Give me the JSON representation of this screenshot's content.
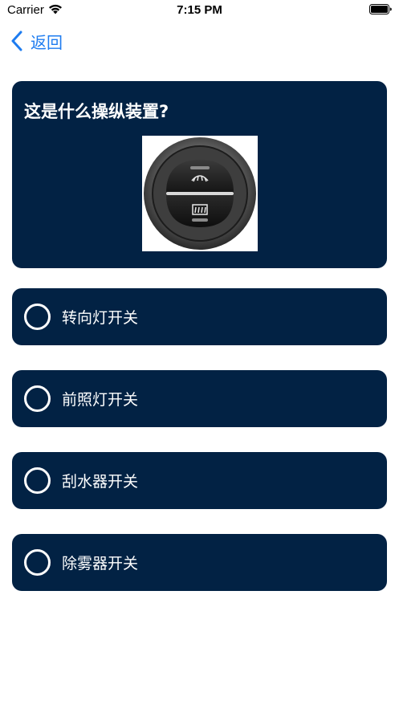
{
  "status_bar": {
    "carrier": "Carrier",
    "time": "7:15 PM"
  },
  "nav": {
    "back_label": "返回"
  },
  "question": {
    "text": "这是什么操纵装置?"
  },
  "options": [
    {
      "label": "转向灯开关"
    },
    {
      "label": "前照灯开关"
    },
    {
      "label": "刮水器开关"
    },
    {
      "label": "除雾器开关"
    }
  ],
  "colors": {
    "card_background": "#022244",
    "accent": "#1e7cf0",
    "text_on_card": "#ffffff"
  }
}
